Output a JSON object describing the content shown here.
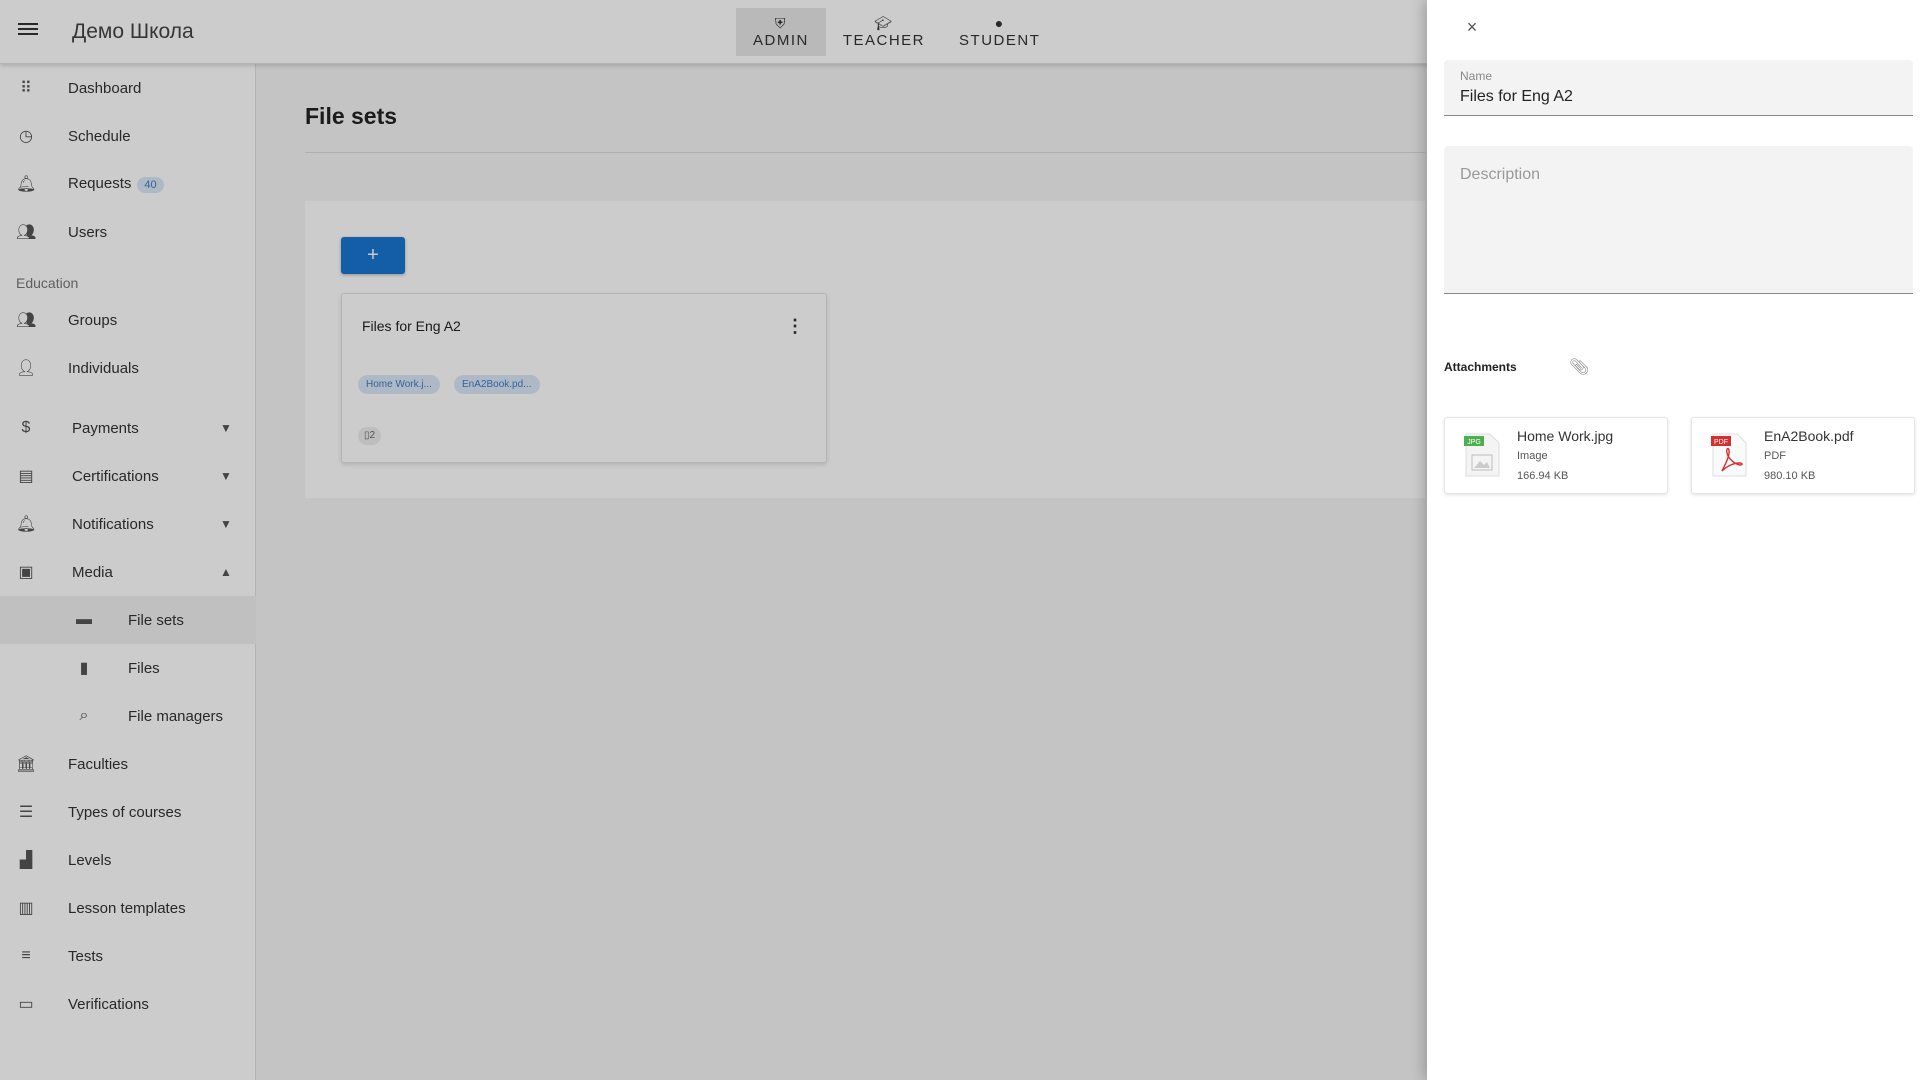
{
  "header": {
    "title": "Демо Школа",
    "roles": [
      {
        "label": "ADMIN",
        "icon": "shield-icon",
        "active": true
      },
      {
        "label": "TEACHER",
        "icon": "graduation-cap-icon",
        "active": false
      },
      {
        "label": "STUDENT",
        "icon": "person-icon",
        "active": false
      }
    ]
  },
  "sidebar": {
    "items": [
      {
        "label": "Dashboard",
        "icon": "grid-icon"
      },
      {
        "label": "Schedule",
        "icon": "calendar-clock-icon"
      },
      {
        "label": "Requests",
        "icon": "bell-ringing-icon",
        "badge": "40"
      },
      {
        "label": "Users",
        "icon": "people-icon"
      }
    ],
    "section_label": "Education",
    "education": [
      {
        "label": "Groups",
        "icon": "people-icon"
      },
      {
        "label": "Individuals",
        "icon": "person-icon"
      }
    ],
    "groups": [
      {
        "label": "Payments",
        "icon": "dollar-icon",
        "expanded": false
      },
      {
        "label": "Certifications",
        "icon": "certificate-icon",
        "expanded": false
      },
      {
        "label": "Notifications",
        "icon": "bell-icon",
        "expanded": false
      },
      {
        "label": "Media",
        "icon": "photo-library-icon",
        "expanded": true
      }
    ],
    "media_children": [
      {
        "label": "File sets",
        "icon": "archive-icon",
        "selected": true
      },
      {
        "label": "Files",
        "icon": "file-icon",
        "selected": false
      },
      {
        "label": "File managers",
        "icon": "file-search-icon",
        "selected": false
      }
    ],
    "more": [
      {
        "label": "Faculties",
        "icon": "bank-icon"
      },
      {
        "label": "Types of courses",
        "icon": "list-icon"
      },
      {
        "label": "Levels",
        "icon": "bar-chart-icon"
      },
      {
        "label": "Lesson templates",
        "icon": "clipboard-icon"
      },
      {
        "label": "Tests",
        "icon": "checklist-icon"
      },
      {
        "label": "Verifications",
        "icon": "feedback-icon"
      }
    ]
  },
  "main": {
    "page_title": "File sets",
    "add_button_label": "+",
    "card": {
      "title": "Files for Eng A2",
      "chips": [
        "Home Work.j...",
        "EnA2Book.pd..."
      ],
      "file_count": "2"
    }
  },
  "drawer": {
    "close_label": "×",
    "name_label": "Name",
    "name_value": "Files for Eng A2",
    "description_placeholder": "Description",
    "attachments_title": "Attachments",
    "attachments": [
      {
        "name": "Home Work.jpg",
        "type": "Image",
        "size": "166.94 KB",
        "icon": "jpg-file-icon",
        "badge": "JPG",
        "color": "#4caf50"
      },
      {
        "name": "EnA2Book.pdf",
        "type": "PDF",
        "size": "980.10 KB",
        "icon": "pdf-file-icon",
        "badge": "PDF",
        "color": "#d32f2f"
      }
    ]
  }
}
